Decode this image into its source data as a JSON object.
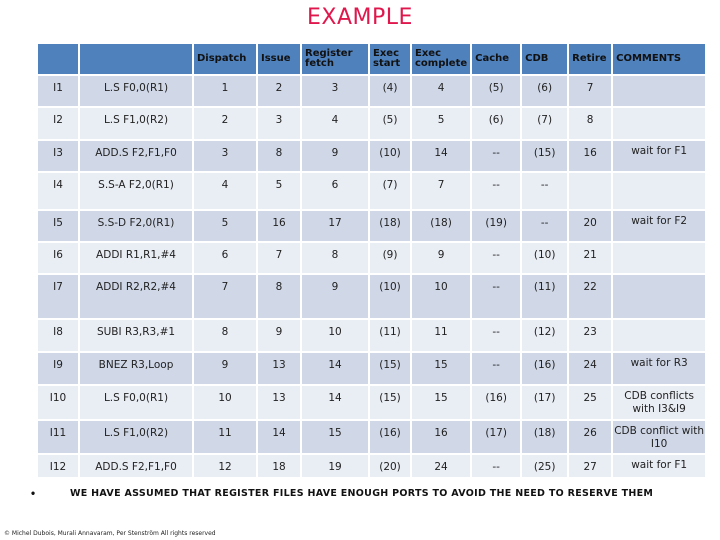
{
  "title": "EXAMPLE",
  "table": {
    "headers": [
      "",
      "",
      "Dispatch",
      "Issue",
      "Register fetch",
      "Exec start",
      "Exec complete",
      "Cache",
      "CDB",
      "Retire",
      "COMMENTS"
    ],
    "rows": [
      {
        "id": "I1",
        "instr": "L.S F0,0(R1)",
        "dispatch": "1",
        "issue": "2",
        "regfetch": "3",
        "exec_start": "(4)",
        "exec_complete": "4",
        "cache": "(5)",
        "cdb": "(6)",
        "retire": "7",
        "comment": ""
      },
      {
        "id": "I2",
        "instr": "L.S F1,0(R2)",
        "dispatch": "2",
        "issue": "3",
        "regfetch": "4",
        "exec_start": "(5)",
        "exec_complete": "5",
        "cache": "(6)",
        "cdb": "(7)",
        "retire": "8",
        "comment": ""
      },
      {
        "id": "I3",
        "instr": "ADD.S F2,F1,F0",
        "dispatch": "3",
        "issue": "8",
        "regfetch": "9",
        "exec_start": "(10)",
        "exec_complete": "14",
        "cache": "--",
        "cdb": "(15)",
        "retire": "16",
        "comment": "wait for F1"
      },
      {
        "id": "I4",
        "instr": "S.S-A F2,0(R1)",
        "dispatch": "4",
        "issue": "5",
        "regfetch": "6",
        "exec_start": "(7)",
        "exec_complete": "7",
        "cache": "--",
        "cdb": "--",
        "retire": "",
        "comment": ""
      },
      {
        "id": "I5",
        "instr": "S.S-D F2,0(R1)",
        "dispatch": "5",
        "issue": "16",
        "regfetch": "17",
        "exec_start": "(18)",
        "exec_complete": "(18)",
        "cache": "(19)",
        "cdb": "--",
        "retire": "20",
        "comment": "wait for F2"
      },
      {
        "id": "I6",
        "instr": "ADDI R1,R1,#4",
        "dispatch": "6",
        "issue": "7",
        "regfetch": "8",
        "exec_start": "(9)",
        "exec_complete": "9",
        "cache": "--",
        "cdb": "(10)",
        "retire": "21",
        "comment": ""
      },
      {
        "id": "I7",
        "instr": "ADDI R2,R2,#4",
        "dispatch": "7",
        "issue": "8",
        "regfetch": "9",
        "exec_start": "(10)",
        "exec_complete": "10",
        "cache": "--",
        "cdb": "(11)",
        "retire": "22",
        "comment": ""
      },
      {
        "id": "I8",
        "instr": "SUBI R3,R3,#1",
        "dispatch": "8",
        "issue": "9",
        "regfetch": "10",
        "exec_start": "(11)",
        "exec_complete": "11",
        "cache": "--",
        "cdb": "(12)",
        "retire": "23",
        "comment": ""
      },
      {
        "id": "I9",
        "instr": "BNEZ R3,Loop",
        "dispatch": "9",
        "issue": "13",
        "regfetch": "14",
        "exec_start": "(15)",
        "exec_complete": "15",
        "cache": "--",
        "cdb": "(16)",
        "retire": "24",
        "comment": "wait for R3"
      },
      {
        "id": "I10",
        "instr": "L.S F0,0(R1)",
        "dispatch": "10",
        "issue": "13",
        "regfetch": "14",
        "exec_start": "(15)",
        "exec_complete": "15",
        "cache": "(16)",
        "cdb": "(17)",
        "retire": "25",
        "comment": "CDB conflicts with I3&I9"
      },
      {
        "id": "I11",
        "instr": "L.S F1,0(R2)",
        "dispatch": "11",
        "issue": "14",
        "regfetch": "15",
        "exec_start": "(16)",
        "exec_complete": "16",
        "cache": "(17)",
        "cdb": "(18)",
        "retire": "26",
        "comment": "CDB conflict with I10"
      },
      {
        "id": "I12",
        "instr": "ADD.S F2,F1,F0",
        "dispatch": "12",
        "issue": "18",
        "regfetch": "19",
        "exec_start": "(20)",
        "exec_complete": "24",
        "cache": "--",
        "cdb": "(25)",
        "retire": "27",
        "comment": "wait for F1"
      }
    ]
  },
  "note": {
    "bullet": "•",
    "text": "WE HAVE ASSUMED THAT REGISTER FILES HAVE ENOUGH PORTS TO AVOID THE NEED TO RESERVE THEM"
  },
  "copyright": "© Michel Dubois, Murali Annavaram, Per Stenström All rights reserved",
  "colors": {
    "title": "#e0174d",
    "header": "#4f81bd",
    "row_dark": "#d0d8e8",
    "row_light": "#e9edf4"
  }
}
